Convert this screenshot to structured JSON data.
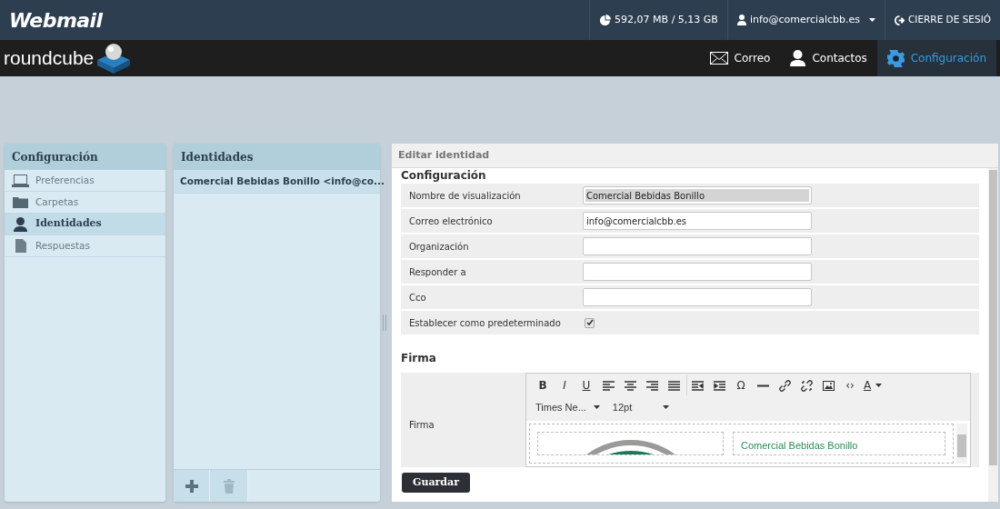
{
  "header": {
    "logo": "Webmail",
    "quota": "592,07 MB / 5,13 GB",
    "user": "info@comercialcbb.es",
    "logout": "CIERRE DE SESIÓ"
  },
  "app_bar": {
    "logo": "roundcube",
    "nav": [
      {
        "kind": "mail",
        "label": "Correo",
        "selected": false
      },
      {
        "kind": "contacts",
        "label": "Contactos",
        "selected": false
      },
      {
        "kind": "settings",
        "label": "Configuración",
        "selected": true
      }
    ]
  },
  "settings_panel": {
    "title": "Configuración",
    "items": [
      {
        "kind": "laptop",
        "label": "Preferencias",
        "selected": false
      },
      {
        "kind": "folder",
        "label": "Carpetas",
        "selected": false
      },
      {
        "kind": "person",
        "label": "Identidades",
        "selected": true
      },
      {
        "kind": "file",
        "label": "Respuestas",
        "selected": false
      }
    ]
  },
  "identities_panel": {
    "title": "Identidades",
    "items": [
      {
        "label": "Comercial Bebidas Bonillo <info@co...",
        "selected": true
      }
    ]
  },
  "edit_panel": {
    "title": "Editar identidad",
    "section_title": "Configuración",
    "fields": [
      {
        "kind": "text",
        "label": "Nombre de visualización",
        "value": "Comercial Bebidas Bonillo",
        "highlighted": true
      },
      {
        "kind": "text",
        "label": "Correo electrónico",
        "value": "info@comercialcbb.es",
        "highlighted": false
      },
      {
        "kind": "text",
        "label": "Organización",
        "highlighted": false
      },
      {
        "kind": "text",
        "label": "Responder a",
        "highlighted": false
      },
      {
        "kind": "text",
        "label": "Cco",
        "highlighted": false
      },
      {
        "kind": "checkbox",
        "label": "Establecer como predeterminado",
        "checked": true
      }
    ],
    "signature_title": "Firma",
    "signature_label": "Firma",
    "toolbar": [
      {
        "kind": "text",
        "label": "B"
      },
      {
        "kind": "text",
        "label": "I"
      },
      {
        "kind": "text",
        "label": "U"
      },
      {
        "kind": "align-left"
      },
      {
        "kind": "align-center"
      },
      {
        "kind": "align-right"
      },
      {
        "kind": "justify"
      },
      {
        "kind": "outdent"
      },
      {
        "kind": "indent"
      },
      {
        "kind": "text",
        "label": "Ω"
      },
      {
        "kind": "rule"
      },
      {
        "kind": "link"
      },
      {
        "kind": "unlink"
      },
      {
        "kind": "image"
      },
      {
        "kind": "text",
        "label": "‹›"
      },
      {
        "kind": "text-color",
        "label": "A"
      }
    ],
    "font_family": "Times Ne...",
    "font_size": "12pt",
    "signature_text": "Comercial Bebidas Bonillo",
    "save_button": "Guardar"
  }
}
